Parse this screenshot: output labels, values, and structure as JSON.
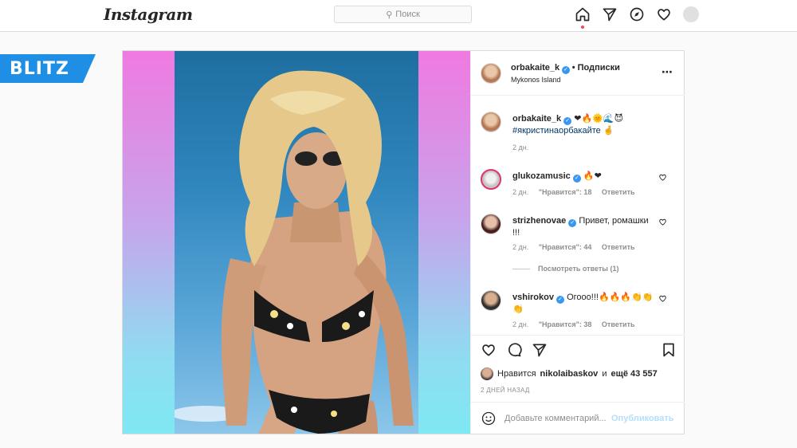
{
  "nav": {
    "logo": "Instagram",
    "search_placeholder": "Поиск",
    "icons": [
      "home-icon",
      "direct-icon",
      "explore-icon",
      "activity-heart-icon",
      "profile-avatar"
    ]
  },
  "badge": {
    "text": "BLITZ",
    "color": "#1f8fe6"
  },
  "post": {
    "author": {
      "username": "orbakaite_k",
      "follow_text": "• Подписки",
      "location": "Mykonos Island"
    },
    "caption": {
      "username": "orbakaite_k",
      "emojis": "❤🔥🌞🌊😈",
      "hashtag": "#якристинаорбакайте",
      "hashtag_emoji": "🤞",
      "time": "2 дн."
    },
    "comments": [
      {
        "username": "glukozamusic",
        "text": "🔥❤",
        "time": "2 дн.",
        "likes": "\"Нравится\": 18",
        "reply": "Ответить"
      },
      {
        "username": "strizhenovae",
        "text": "Привет, ромашки !!!",
        "time": "2 дн.",
        "likes": "\"Нравится\": 44",
        "reply": "Ответить",
        "view_replies": "Посмотреть ответы (1)"
      },
      {
        "username": "vshirokov",
        "text": "Огооо!!!🔥🔥🔥👏👏👏",
        "time": "2 дн.",
        "likes": "\"Нравится\": 38",
        "reply": "Ответить"
      }
    ],
    "likes_prefix": "Нравится",
    "likes_user": "nikolaibaskov",
    "likes_middle": "и",
    "likes_more": "ещё 43 557",
    "date": "2 ДНЕЙ НАЗАД",
    "add_comment_placeholder": "Добавьте комментарий...",
    "publish_label": "Опубликовать"
  },
  "colors": {
    "accent": "#3897f0",
    "gradient_top": "#f07ae0",
    "gradient_bottom": "#7fe8f2"
  }
}
